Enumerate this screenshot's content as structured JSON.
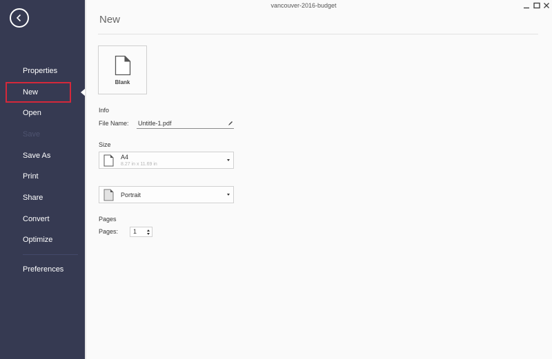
{
  "window": {
    "title": "vancouver-2016-budget",
    "controls": {
      "minimize": "–",
      "maximize": "□",
      "close": "✕"
    }
  },
  "sidebar": {
    "back_icon": "back-arrow-circle-icon",
    "active_item": "New",
    "items": [
      {
        "label": "Properties",
        "enabled": true
      },
      {
        "label": "New",
        "enabled": true,
        "active": true
      },
      {
        "label": "Open",
        "enabled": true
      },
      {
        "label": "Save",
        "enabled": false
      },
      {
        "label": "Save As",
        "enabled": true
      },
      {
        "label": "Print",
        "enabled": true
      },
      {
        "label": "Share",
        "enabled": true
      },
      {
        "label": "Convert",
        "enabled": true
      },
      {
        "label": "Optimize",
        "enabled": true
      },
      {
        "label": "Preferences",
        "enabled": true
      }
    ],
    "colors": {
      "background": "#363a52",
      "active_outline": "#d6283a",
      "disabled_text": "#4f5470"
    }
  },
  "main": {
    "title": "New",
    "template": {
      "label": "Blank",
      "icon": "blank-document-icon"
    },
    "info": {
      "heading": "Info",
      "file_name_label": "File Name:",
      "file_name_value": "Untitle-1.pdf",
      "edit_icon": "pencil-icon"
    },
    "size": {
      "heading": "Size",
      "selected": "A4",
      "dimensions": "8.27 in x 11.69 in"
    },
    "orientation": {
      "selected": "Portrait"
    },
    "pages": {
      "heading": "Pages",
      "label": "Pages:",
      "value": "1"
    }
  }
}
